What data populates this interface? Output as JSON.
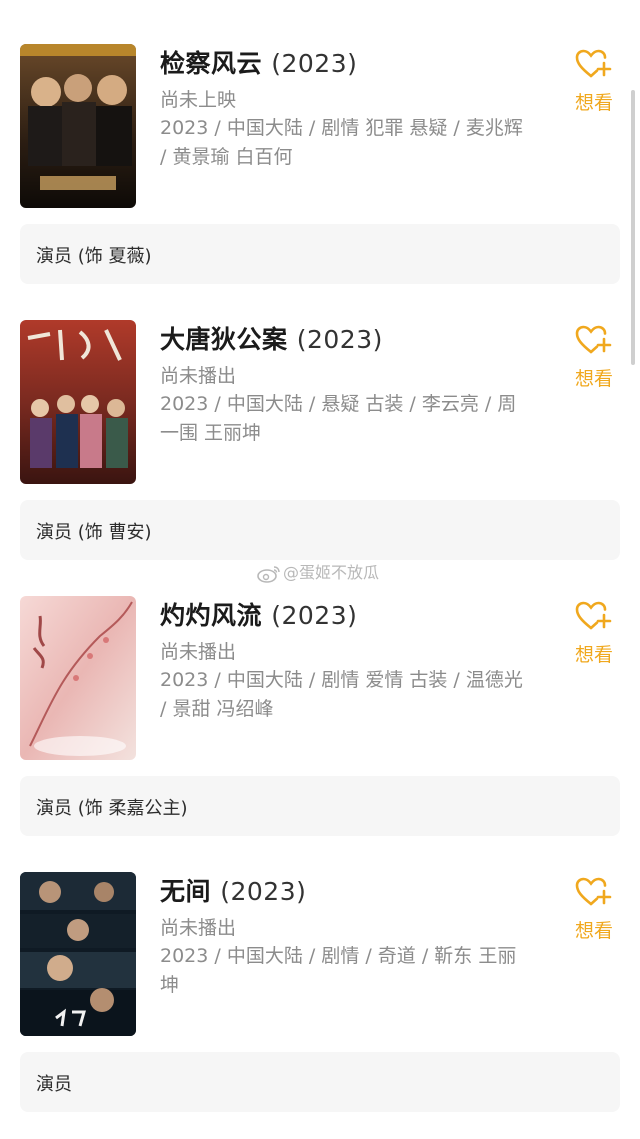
{
  "colors": {
    "accent": "#f0a81e",
    "meta": "#8c8c8c",
    "role_bg": "#f6f6f6"
  },
  "wish_label": "想看",
  "watermark": "@蛋姬不放瓜",
  "items": [
    {
      "title": "检察风云",
      "year": "(2023)",
      "status": "尚未上映",
      "meta": "2023 / 中国大陆 / 剧情 犯罪 悬疑 / 麦兆辉 / 黄景瑜 白百何",
      "role": "演员 (饰 夏薇)",
      "poster_icon": "movie-poster"
    },
    {
      "title": "大唐狄公案",
      "year": "(2023)",
      "status": "尚未播出",
      "meta": "2023 / 中国大陆 / 悬疑 古装 / 李云亮 / 周一围 王丽坤",
      "role": "演员 (饰 曹安)",
      "poster_icon": "tv-poster"
    },
    {
      "title": "灼灼风流",
      "year": "(2023)",
      "status": "尚未播出",
      "meta": "2023 / 中国大陆 / 剧情 爱情 古装 / 温德光 / 景甜 冯绍峰",
      "role": "演员 (饰 柔嘉公主)",
      "poster_icon": "tv-poster"
    },
    {
      "title": "无间",
      "year": "(2023)",
      "status": "尚未播出",
      "meta": "2023 / 中国大陆 / 剧情 / 奇道 / 靳东 王丽坤",
      "role": "演员",
      "poster_icon": "tv-poster"
    }
  ]
}
